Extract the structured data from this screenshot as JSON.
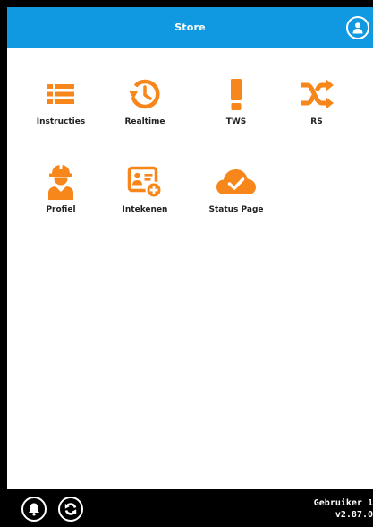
{
  "header": {
    "title": "Store",
    "bg_color": "#1098e0"
  },
  "accent_color": "#f7861b",
  "tiles": [
    {
      "label": "Instructies",
      "icon": "list-icon"
    },
    {
      "label": "Realtime",
      "icon": "clock-history-icon"
    },
    {
      "label": "TWS",
      "icon": "exclamation-icon"
    },
    {
      "label": "RS",
      "icon": "shuffle-icon"
    },
    {
      "label": "Profiel",
      "icon": "worker-icon"
    },
    {
      "label": "Intekenen",
      "icon": "id-card-add-icon"
    },
    {
      "label": "Status Page",
      "icon": "cloud-check-icon"
    }
  ],
  "footer": {
    "user": "Gebruiker 1",
    "version": "v2.87.0"
  }
}
